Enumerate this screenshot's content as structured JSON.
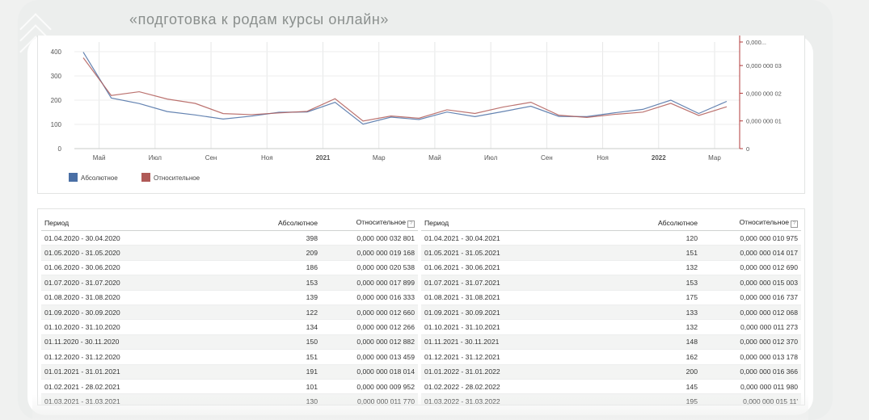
{
  "page": {
    "title": "«подготовка к родам курсы онлайн»"
  },
  "colors": {
    "absolute": "#4a6fa5",
    "relative": "#b05a57",
    "accent": "#b03838",
    "background": "#f0f1f0"
  },
  "chart_data": {
    "type": "line",
    "categories": [
      "04.2020",
      "05.2020",
      "06.2020",
      "07.2020",
      "08.2020",
      "09.2020",
      "10.2020",
      "11.2020",
      "12.2020",
      "01.2021",
      "02.2021",
      "03.2021",
      "04.2021",
      "05.2021",
      "06.2021",
      "07.2021",
      "08.2021",
      "09.2021",
      "10.2021",
      "11.2021",
      "12.2021",
      "01.2022",
      "02.2022",
      "03.2022"
    ],
    "x_tick_labels": [
      "Май",
      "Июл",
      "Сен",
      "Ноя",
      "2021",
      "Мар",
      "Май",
      "Июл",
      "Сен",
      "Ноя",
      "2022",
      "Мар"
    ],
    "y_left_ticks": [
      "0",
      "100",
      "200",
      "300",
      "400"
    ],
    "y_right_ticks": [
      "0",
      "0,000 000 01",
      "0,000 000 02",
      "0,000 000 03",
      "0,000..."
    ],
    "ylim_left": [
      0,
      440
    ],
    "ylim_right": [
      0,
      3.85e-08
    ],
    "series": [
      {
        "name": "Абсолютное",
        "axis": "left",
        "values": [
          398,
          209,
          186,
          153,
          139,
          122,
          134,
          150,
          151,
          191,
          101,
          130,
          120,
          151,
          132,
          153,
          175,
          133,
          132,
          148,
          162,
          200,
          145,
          195
        ]
      },
      {
        "name": "Относительное",
        "axis": "right",
        "values": [
          3.2801e-08,
          1.9168e-08,
          2.0538e-08,
          1.7899e-08,
          1.6333e-08,
          1.266e-08,
          1.2266e-08,
          1.2882e-08,
          1.3459e-08,
          1.8014e-08,
          9.952e-09,
          1.177e-08,
          1.0975e-08,
          1.4017e-08,
          1.269e-08,
          1.5003e-08,
          1.6737e-08,
          1.2068e-08,
          1.1273e-08,
          1.237e-08,
          1.3178e-08,
          1.6366e-08,
          1.198e-08,
          1.511e-08
        ]
      }
    ],
    "legend": [
      {
        "label": "Абсолютное",
        "color": "#4a6fa5"
      },
      {
        "label": "Относительное",
        "color": "#b05a57"
      }
    ],
    "legend_position": "bottom-left",
    "grid": true
  },
  "table": {
    "headers": {
      "period": "Период",
      "absolute": "Абсолютное",
      "relative": "Относительное"
    },
    "left_rows": [
      [
        "01.04.2020 - 30.04.2020",
        "398",
        "0,000 000 032 801"
      ],
      [
        "01.05.2020 - 31.05.2020",
        "209",
        "0,000 000 019 168"
      ],
      [
        "01.06.2020 - 30.06.2020",
        "186",
        "0,000 000 020 538"
      ],
      [
        "01.07.2020 - 31.07.2020",
        "153",
        "0,000 000 017 899"
      ],
      [
        "01.08.2020 - 31.08.2020",
        "139",
        "0,000 000 016 333"
      ],
      [
        "01.09.2020 - 30.09.2020",
        "122",
        "0,000 000 012 660"
      ],
      [
        "01.10.2020 - 31.10.2020",
        "134",
        "0,000 000 012 266"
      ],
      [
        "01.11.2020 - 30.11.2020",
        "150",
        "0,000 000 012 882"
      ],
      [
        "01.12.2020 - 31.12.2020",
        "151",
        "0,000 000 013 459"
      ],
      [
        "01.01.2021 - 31.01.2021",
        "191",
        "0,000 000 018 014"
      ],
      [
        "01.02.2021 - 28.02.2021",
        "101",
        "0,000 000 009 952"
      ],
      [
        "01.03.2021 - 31.03.2021",
        "130",
        "0,000 000 011 770"
      ]
    ],
    "right_rows": [
      [
        "01.04.2021 - 30.04.2021",
        "120",
        "0,000 000 010 975"
      ],
      [
        "01.05.2021 - 31.05.2021",
        "151",
        "0,000 000 014 017"
      ],
      [
        "01.06.2021 - 30.06.2021",
        "132",
        "0,000 000 012 690"
      ],
      [
        "01.07.2021 - 31.07.2021",
        "153",
        "0,000 000 015 003"
      ],
      [
        "01.08.2021 - 31.08.2021",
        "175",
        "0,000 000 016 737"
      ],
      [
        "01.09.2021 - 30.09.2021",
        "133",
        "0,000 000 012 068"
      ],
      [
        "01.10.2021 - 31.10.2021",
        "132",
        "0,000 000 011 273"
      ],
      [
        "01.11.2021 - 30.11.2021",
        "148",
        "0,000 000 012 370"
      ],
      [
        "01.12.2021 - 31.12.2021",
        "162",
        "0,000 000 013 178"
      ],
      [
        "01.01.2022 - 31.01.2022",
        "200",
        "0,000 000 016 366"
      ],
      [
        "01.02.2022 - 28.02.2022",
        "145",
        "0,000 000 011 980"
      ],
      [
        "01.03.2022 - 31.03.2022",
        "195",
        "0,000 000 015 11'"
      ]
    ]
  }
}
